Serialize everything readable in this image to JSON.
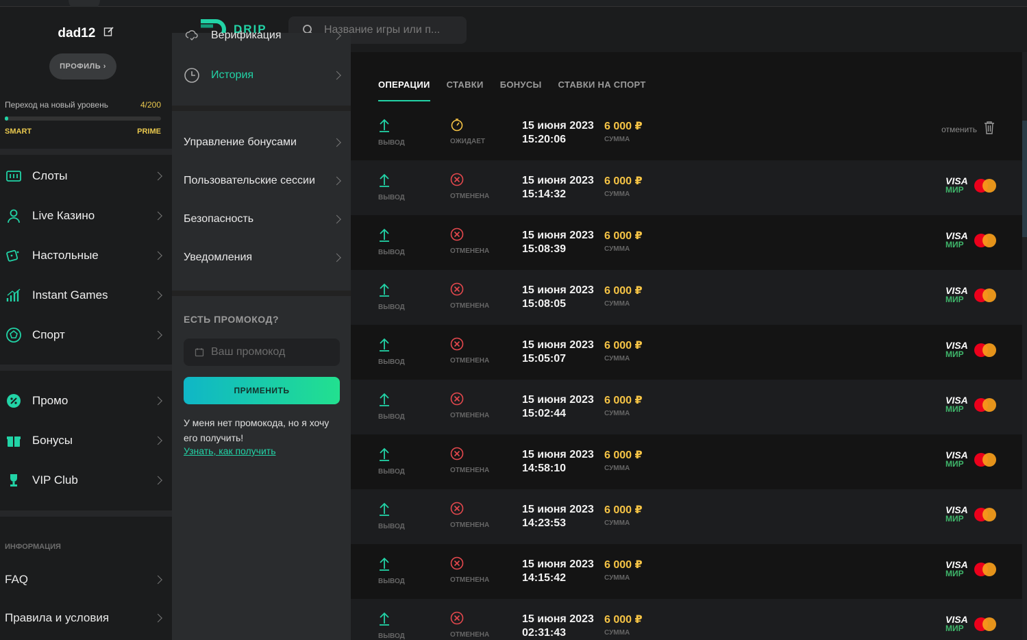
{
  "user": {
    "name": "dad12",
    "profile_label": "ПРОФИЛЬ",
    "level_text": "Переход на новый уровень",
    "level_count": "4/200",
    "level_progress": 0.02,
    "rank_current": "SMART",
    "rank_next": "PRIME"
  },
  "header": {
    "logo": "DRIP",
    "search_placeholder": "Название игры или п..."
  },
  "sidebar": {
    "items": [
      {
        "label": "Слоты",
        "icon": "slots-icon"
      },
      {
        "label": "Live Казино",
        "icon": "dealer-icon"
      },
      {
        "label": "Настольные",
        "icon": "dice-icon"
      },
      {
        "label": "Instant Games",
        "icon": "bars-icon"
      },
      {
        "label": "Спорт",
        "icon": "ball-icon"
      }
    ],
    "items2": [
      {
        "label": "Промо",
        "icon": "percent-icon"
      },
      {
        "label": "Бонусы",
        "icon": "gift-icon"
      },
      {
        "label": "VIP Club",
        "icon": "trophy-icon"
      }
    ],
    "info_title": "ИНФОРМАЦИЯ",
    "info_items": [
      {
        "label": "FAQ"
      },
      {
        "label": "Правила и условия"
      }
    ]
  },
  "settings_menu": {
    "top_items": [
      {
        "label": "Верификация",
        "icon": "cloud-verify-icon"
      },
      {
        "label": "История",
        "icon": "clock-icon",
        "active": true
      }
    ],
    "items": [
      {
        "label": "Управление бонусами"
      },
      {
        "label": "Пользовательские сессии"
      },
      {
        "label": "Безопасность"
      },
      {
        "label": "Уведомления"
      }
    ]
  },
  "promo": {
    "title": "ЕСТЬ ПРОМОКОД?",
    "placeholder": "Ваш промокод",
    "button": "ПРИМЕНИТЬ",
    "note": "У меня нет промокода, но я хочу его получить!",
    "link": "Узнать, как получить"
  },
  "history": {
    "tabs": [
      "ОПЕРАЦИИ",
      "СТАВКИ",
      "БОНУСЫ",
      "СТАВКИ НА СПОРТ"
    ],
    "active_tab": 0,
    "type_label": "ВЫВОД",
    "amount_label": "СУММА",
    "cancel_label": "отменить",
    "rows": [
      {
        "date": "15 июня 2023",
        "time": "15:20:06",
        "status": "ОЖИДАЕТ",
        "status_type": "pending",
        "amount": "6 000 ₽"
      },
      {
        "date": "15 июня 2023",
        "time": "15:14:32",
        "status": "ОТМЕНЕНА",
        "status_type": "cancelled",
        "amount": "6 000 ₽"
      },
      {
        "date": "15 июня 2023",
        "time": "15:08:39",
        "status": "ОТМЕНЕНА",
        "status_type": "cancelled",
        "amount": "6 000 ₽"
      },
      {
        "date": "15 июня 2023",
        "time": "15:08:05",
        "status": "ОТМЕНЕНА",
        "status_type": "cancelled",
        "amount": "6 000 ₽"
      },
      {
        "date": "15 июня 2023",
        "time": "15:05:07",
        "status": "ОТМЕНЕНА",
        "status_type": "cancelled",
        "amount": "6 000 ₽"
      },
      {
        "date": "15 июня 2023",
        "time": "15:02:44",
        "status": "ОТМЕНЕНА",
        "status_type": "cancelled",
        "amount": "6 000 ₽"
      },
      {
        "date": "15 июня 2023",
        "time": "14:58:10",
        "status": "ОТМЕНЕНА",
        "status_type": "cancelled",
        "amount": "6 000 ₽"
      },
      {
        "date": "15 июня 2023",
        "time": "14:23:53",
        "status": "ОТМЕНЕНА",
        "status_type": "cancelled",
        "amount": "6 000 ₽"
      },
      {
        "date": "15 июня 2023",
        "time": "14:15:42",
        "status": "ОТМЕНЕНА",
        "status_type": "cancelled",
        "amount": "6 000 ₽"
      },
      {
        "date": "15 июня 2023",
        "time": "02:31:43",
        "status": "ОТМЕНЕНА",
        "status_type": "cancelled",
        "amount": "6 000 ₽"
      }
    ],
    "payment": {
      "visa": "VISA",
      "mir": "МИР"
    }
  },
  "colors": {
    "accent": "#22d3a6",
    "amount": "#f6c445",
    "cancelled": "#e5484d",
    "pending": "#f6c445",
    "rank": "#e9c84e"
  }
}
